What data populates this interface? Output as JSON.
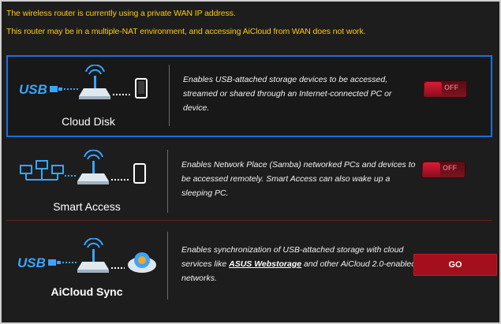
{
  "warning": {
    "line1": "The wireless router is currently using a private WAN IP address.",
    "line2": "This router may be in a multiple-NAT environment, and accessing AiCloud from WAN does not work."
  },
  "cloud_disk": {
    "title": "Cloud Disk",
    "usb_text": "USB",
    "description": "Enables USB-attached storage devices to be accessed, streamed or shared through an Internet-connected PC or device.",
    "toggle_state": "OFF"
  },
  "smart_access": {
    "title": "Smart Access",
    "description": "Enables Network Place (Samba) networked PCs and devices to be accessed remotely. Smart Access can also wake up a sleeping PC.",
    "toggle_state": "OFF"
  },
  "aicloud_sync": {
    "title": "AiCloud Sync",
    "usb_text": "USB",
    "description_before": "Enables synchronization of USB-attached storage with cloud services like ",
    "link_text": "ASUS Webstorage",
    "description_after": " and other AiCloud 2.0-enabled networks.",
    "button_label": "GO"
  },
  "colors": {
    "warning_text": "#ffcc00",
    "selected_border": "#1e6fd9",
    "icon_blue": "#3aa4ff",
    "button_red": "#a30f1c"
  }
}
